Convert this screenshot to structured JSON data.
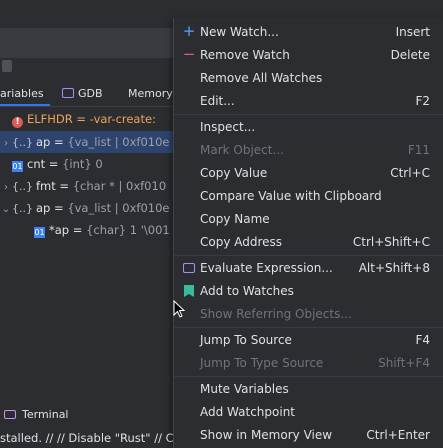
{
  "variables_panel": {
    "tabs": [
      {
        "label": "ariables"
      },
      {
        "label": "GDB"
      },
      {
        "label": "Memory"
      }
    ],
    "rows": [
      {
        "text": "ELFHDR = -var-create:"
      },
      {
        "name": "ap",
        "eq": " = ",
        "value": "{va_list | 0xf010e"
      },
      {
        "name": "cnt",
        "eq": " = ",
        "value": "{int} 0"
      },
      {
        "name": "fmt",
        "eq": " = ",
        "value": "{char * | 0xf010"
      },
      {
        "name": "ap",
        "eq": " = ",
        "value": "{va_list | 0xf010e"
      },
      {
        "name": "*ap",
        "eq": " = ",
        "value": "{char} 1 '\\001"
      }
    ]
  },
  "terminal": {
    "label": "Terminal"
  },
  "status_bar": {
    "text": "stalled. // // Disable \"Rust\" // C"
  },
  "context_menu": {
    "items": [
      {
        "label": "New Watch...",
        "shortcut": "Insert"
      },
      {
        "label": "Remove Watch",
        "shortcut": "Delete"
      },
      {
        "label": "Remove All Watches",
        "shortcut": ""
      },
      {
        "label": "Edit...",
        "shortcut": "F2"
      },
      {
        "label": "Inspect...",
        "shortcut": ""
      },
      {
        "label": "Mark Object...",
        "shortcut": "F11"
      },
      {
        "label": "Copy Value",
        "shortcut": "Ctrl+C"
      },
      {
        "label": "Compare Value with Clipboard",
        "shortcut": ""
      },
      {
        "label": "Copy Name",
        "shortcut": ""
      },
      {
        "label": "Copy Address",
        "shortcut": "Ctrl+Shift+C"
      },
      {
        "label": "Evaluate Expression...",
        "shortcut": "Alt+Shift+8"
      },
      {
        "label": "Add to Watches",
        "shortcut": ""
      },
      {
        "label": "Show Referring Objects...",
        "shortcut": ""
      },
      {
        "label": "Jump To Source",
        "shortcut": "F4"
      },
      {
        "label": "Jump To Type Source",
        "shortcut": "Shift+F4"
      },
      {
        "label": "Mute Variables",
        "shortcut": ""
      },
      {
        "label": "Add Watchpoint",
        "shortcut": ""
      },
      {
        "label": "Show in Memory View",
        "shortcut": "Ctrl+Enter"
      }
    ]
  },
  "colors": {
    "accent": "#3574f0",
    "selection": "#2e436e",
    "background": "#2b2d30",
    "error": "#db5c5c"
  }
}
